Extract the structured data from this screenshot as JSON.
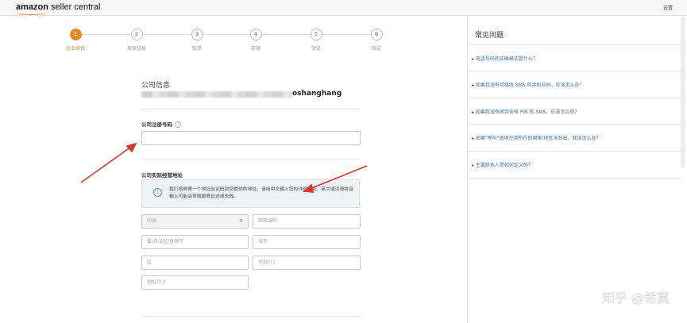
{
  "header": {
    "logo_brand": "amazon",
    "logo_suffix": "seller central",
    "settings_label": "设置"
  },
  "stepper": {
    "steps": [
      {
        "number": "1",
        "label": "企业资讯",
        "active": true
      },
      {
        "number": "2",
        "label": "卖家信息",
        "active": false
      },
      {
        "number": "3",
        "label": "账单",
        "active": false
      },
      {
        "number": "4",
        "label": "店铺",
        "active": false
      },
      {
        "number": "5",
        "label": "验证",
        "active": false
      },
      {
        "number": "6",
        "label": "验证",
        "active": false
      }
    ],
    "active_color": "#e48a2a"
  },
  "form": {
    "company_info_heading": "公司信息",
    "company_name_suffix": "oshanghang",
    "registration_label": "公司注册号码",
    "registration_value": "",
    "address_heading": "公司实际经营地址",
    "info_message": "我们将邮寄一个地址验证码到您提供的地址，请用中文输入您的详细地址。英文或汉语拼音输入可能会导致邮寄延迟或失败。",
    "fields": {
      "country": "中国",
      "postal_code_placeholder": "邮政编码",
      "province_placeholder": "省/自治区/直辖市",
      "city_placeholder": "城市",
      "district_placeholder": "区",
      "address1_placeholder": "地址行1",
      "address2_placeholder": "地址行 2"
    }
  },
  "faq": {
    "title": "常见问题",
    "items": [
      "电话号码的正确格式是什么？",
      "如果我没有可接收 SMS 的手机号码，应该怎么办？",
      "如果我没有收到含有 PIN 的 SMS，应该怎么办？",
      "如果\"呼叫\"选项在我所在的国家/地区未列出，我该怎么办？",
      "主要联系人是如何定义的？"
    ]
  },
  "watermark": "知乎 @希冀",
  "annotation_color": "#d9372c"
}
